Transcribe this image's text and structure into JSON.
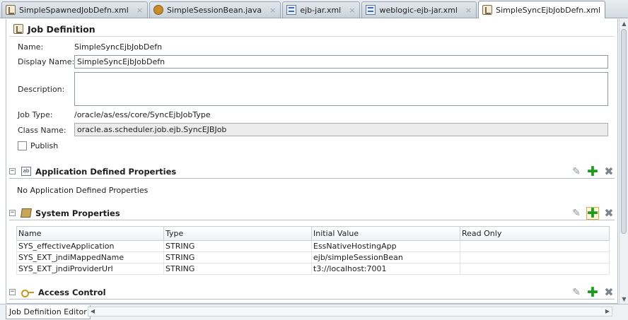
{
  "tabs": [
    {
      "label": "SimpleSpawnedJobDefn.xml",
      "icon": "job-definition-icon",
      "active": false
    },
    {
      "label": "SimpleSessionBean.java",
      "icon": "java-bean-icon",
      "active": false
    },
    {
      "label": "ejb-jar.xml",
      "icon": "xml-file-icon",
      "active": false
    },
    {
      "label": "weblogic-ejb-jar.xml",
      "icon": "xml-file-icon",
      "active": false
    },
    {
      "label": "SimpleSyncEjbJobDefn.xml",
      "icon": "job-definition-icon",
      "active": true
    }
  ],
  "tab_close_glyph": "×",
  "page_title": "Job Definition",
  "form": {
    "name_label": "Name:",
    "name_value": "SimpleSyncEjbJobDefn",
    "display_name_label": "Display Name:",
    "display_name_value": "SimpleSyncEjbJobDefn",
    "description_label": "Description:",
    "description_value": "",
    "job_type_label": "Job Type:",
    "job_type_value": "/oracle/as/ess/core/SyncEjbJobType",
    "class_name_label": "Class Name:",
    "class_name_value": "oracle.as.scheduler.job.ejb.SyncEJBJob",
    "publish_label": "Publish",
    "publish_checked": false
  },
  "sections": {
    "app_props": {
      "title": "Application Defined Properties",
      "icon": "application-properties-icon",
      "empty_text": "No Application Defined Properties"
    },
    "sys_props": {
      "title": "System Properties",
      "icon": "system-properties-icon",
      "columns": [
        "Name",
        "Type",
        "Initial Value",
        "Read Only"
      ],
      "rows": [
        [
          "SYS_effectiveApplication",
          "STRING",
          "EssNativeHostingApp",
          ""
        ],
        [
          "SYS_EXT_jndiMappedName",
          "STRING",
          "ejb/simpleSessionBean",
          ""
        ],
        [
          "SYS_EXT_jndiProviderUrl",
          "STRING",
          "t3://localhost:7001",
          ""
        ]
      ]
    },
    "access_control": {
      "title": "Access Control",
      "icon": "key-icon"
    }
  },
  "actions": {
    "edit_glyph": "✎",
    "add_glyph": "✚",
    "delete_glyph": "✖"
  },
  "toggle_glyph": "−",
  "bottom_tab_label": "Job Definition Editor",
  "colors": {
    "add": "#1f9a1f",
    "tab_border": "#9aa6b3",
    "readonly_bg": "#ececec"
  }
}
